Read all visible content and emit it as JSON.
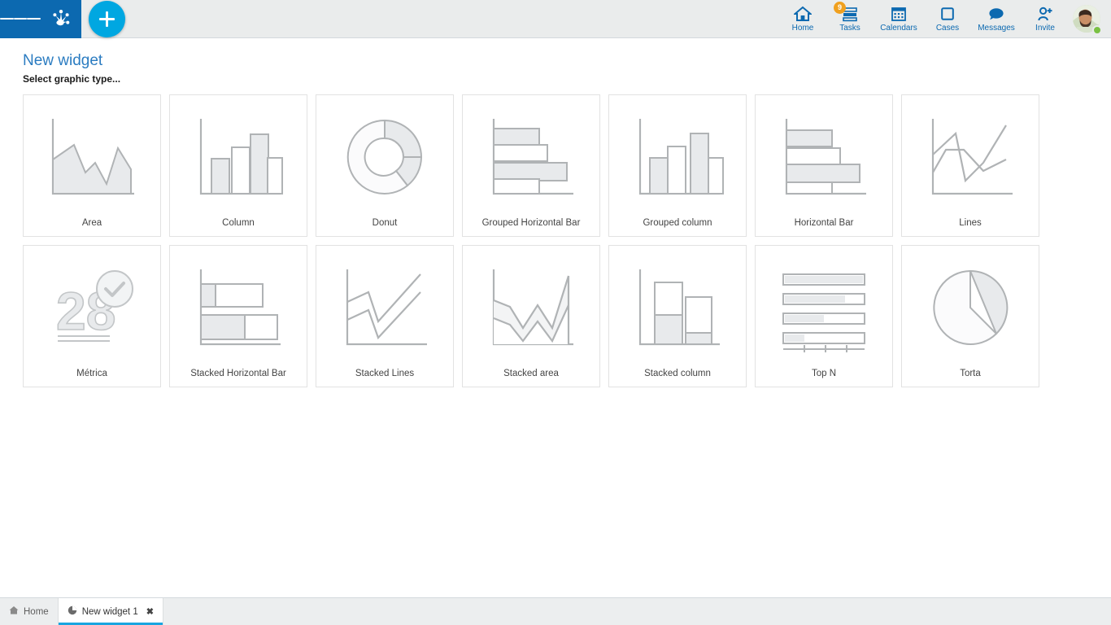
{
  "header": {
    "menu_icon": "hamburger-menu-icon",
    "logo_icon": "app-logo-icon",
    "add_label": "+",
    "nav": [
      {
        "label": "Home",
        "icon": "home-icon",
        "badge": null
      },
      {
        "label": "Tasks",
        "icon": "tasks-icon",
        "badge": "9"
      },
      {
        "label": "Calendars",
        "icon": "calendar-icon",
        "badge": null
      },
      {
        "label": "Cases",
        "icon": "cases-icon",
        "badge": null
      },
      {
        "label": "Messages",
        "icon": "messages-icon",
        "badge": null
      },
      {
        "label": "Invite",
        "icon": "invite-user-icon",
        "badge": null
      }
    ],
    "avatar": {
      "name": "user-avatar",
      "status": "online"
    }
  },
  "page": {
    "title": "New widget",
    "subtitle": "Select graphic type..."
  },
  "graphic_types": [
    {
      "label": "Area",
      "icon": "area-chart-icon"
    },
    {
      "label": "Column",
      "icon": "column-chart-icon"
    },
    {
      "label": "Donut",
      "icon": "donut-chart-icon"
    },
    {
      "label": "Grouped Horizontal Bar",
      "icon": "grouped-horizontal-bar-chart-icon"
    },
    {
      "label": "Grouped column",
      "icon": "grouped-column-chart-icon"
    },
    {
      "label": "Horizontal Bar",
      "icon": "horizontal-bar-chart-icon"
    },
    {
      "label": "Lines",
      "icon": "lines-chart-icon"
    },
    {
      "label": "Métrica",
      "icon": "metric-number-icon"
    },
    {
      "label": "Stacked Horizontal Bar",
      "icon": "stacked-horizontal-bar-chart-icon"
    },
    {
      "label": "Stacked Lines",
      "icon": "stacked-lines-chart-icon"
    },
    {
      "label": "Stacked area",
      "icon": "stacked-area-chart-icon"
    },
    {
      "label": "Stacked column",
      "icon": "stacked-column-chart-icon"
    },
    {
      "label": "Top N",
      "icon": "top-n-chart-icon"
    },
    {
      "label": "Torta",
      "icon": "pie-chart-icon"
    }
  ],
  "metric_icon_value": "28",
  "taskbar": [
    {
      "label": "Home",
      "icon": "home-small-icon",
      "active": false,
      "closable": false
    },
    {
      "label": "New widget 1",
      "icon": "pie-small-icon",
      "active": true,
      "closable": true,
      "close": "✖"
    }
  ],
  "colors": {
    "brand_blue": "#0c69b0",
    "accent_cyan": "#00a7e1",
    "badge_orange": "#f0a01e",
    "status_green": "#7ac143",
    "header_bg": "#eaecec",
    "art_stroke": "#b0b3b5",
    "art_fill": "#e8eaec",
    "tab_underline": "#19a5e0"
  }
}
